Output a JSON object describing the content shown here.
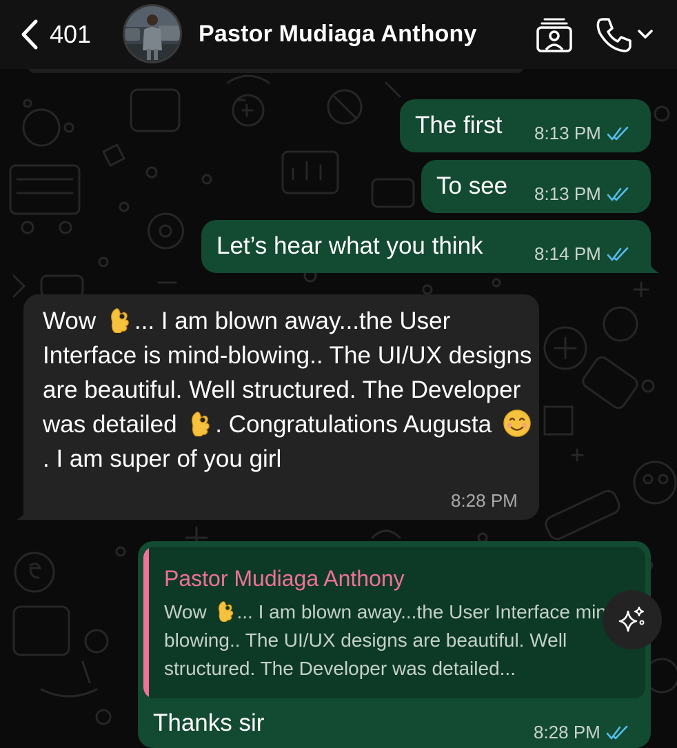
{
  "header": {
    "back_count": "401",
    "contact_name": "Pastor Mudiaga Anthony"
  },
  "messages": [
    {
      "id": "m1",
      "direction": "outgoing",
      "text": "The first",
      "time": "8:13 PM",
      "status": "read"
    },
    {
      "id": "m2",
      "direction": "outgoing",
      "text": "To see",
      "time": "8:13 PM",
      "status": "read"
    },
    {
      "id": "m3",
      "direction": "outgoing",
      "text": "Let’s hear what you think",
      "time": "8:14 PM",
      "status": "read"
    },
    {
      "id": "m4",
      "direction": "incoming",
      "segments": [
        "Wow ",
        "... I am blown away...the User Interface is mind-blowing.. The UI/UX designs are beautiful.  Well structured. The Developer was detailed ",
        ". Congratulations Augusta ",
        ". I am super of you girl"
      ],
      "time": "8:28 PM"
    },
    {
      "id": "m5",
      "direction": "outgoing",
      "quote": {
        "author": "Pastor Mudiaga Anthony",
        "segments": [
          "Wow ",
          "... I am blown away...the User Interface mind-blowing.. The UI/UX designs are beautiful. Well structured.  The Developer was detailed..."
        ]
      },
      "text": "Thanks sir",
      "time": "8:28 PM",
      "status": "read"
    }
  ],
  "colors": {
    "outgoing_bubble": "#134a32",
    "incoming_bubble": "#232323",
    "read_ticks": "#53bdeb",
    "quote_accent": "#f0719a"
  },
  "icons": [
    "chevron-left-icon",
    "video-call-icon",
    "phone-icon",
    "chevron-down-icon",
    "ok-hand-emoji",
    "smiling-face-emoji",
    "sparkle-icon",
    "double-check-icon"
  ]
}
